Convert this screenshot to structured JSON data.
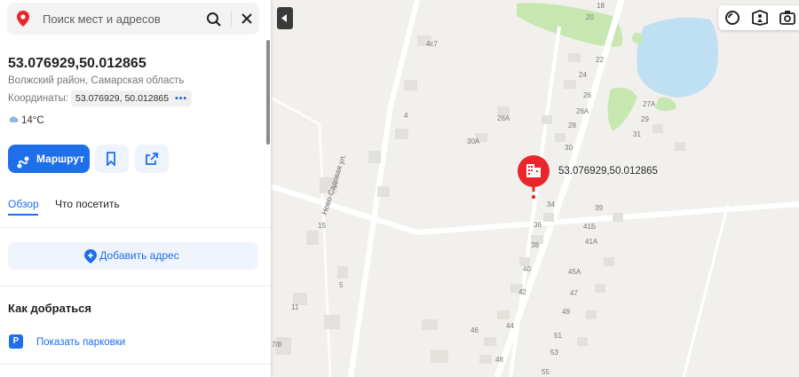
{
  "search": {
    "placeholder": "Поиск мест и адресов"
  },
  "place": {
    "title": "53.076929,50.012865",
    "region": "Волжский район, Самарская область",
    "coords_label": "Координаты:",
    "coords_value": "53.076929, 50.012865",
    "temperature": "14°C"
  },
  "actions": {
    "route_label": "Маршрут",
    "bookmark_icon": "bookmark-icon",
    "share_icon": "share-icon"
  },
  "tabs": [
    {
      "label": "Обзор",
      "active": true
    },
    {
      "label": "Что посетить",
      "active": false
    }
  ],
  "add_address_label": "Добавить адрес",
  "directions": {
    "title": "Как добраться",
    "parking_label": "Показать парковки",
    "parking_badge": "P"
  },
  "map": {
    "marker_label": "53.076929,50.012865",
    "street_name": "Ново-Садовая ул.",
    "house_numbers": [
      "18",
      "20",
      "22",
      "24",
      "26",
      "26А",
      "28",
      "30",
      "34",
      "36",
      "38",
      "40",
      "42",
      "44",
      "46",
      "48",
      "39",
      "41Б",
      "41А",
      "45А",
      "47",
      "49",
      "51",
      "53",
      "55",
      "27А",
      "29",
      "31",
      "4с7",
      "4",
      "28А",
      "30А",
      "15",
      "5",
      "11",
      "7/8"
    ],
    "colors": {
      "background": "#f2f0ec",
      "water": "#bfe0f3",
      "greenery": "#c6e8b0",
      "road": "#ffffff",
      "building": "#e3e1dc",
      "marker": "#e8272c"
    }
  },
  "map_controls": [
    "layers-icon",
    "panorama-icon",
    "camera-icon"
  ],
  "colors": {
    "accent": "#1f6fe8"
  }
}
